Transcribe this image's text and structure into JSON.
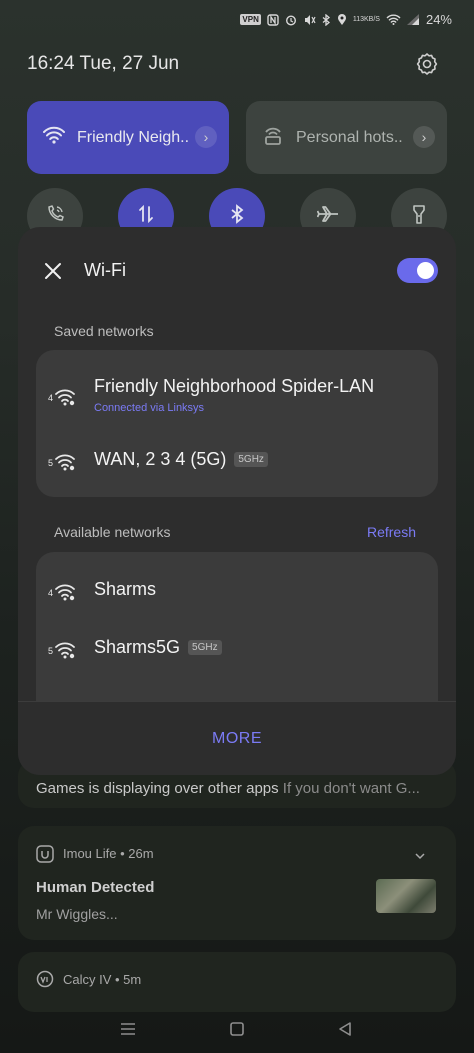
{
  "status_bar": {
    "vpn": "VPN",
    "net_speed_value": "113",
    "net_speed_unit": "KB/S",
    "battery": "24%",
    "icons": [
      "vpn-icon",
      "nfc-icon",
      "alarm-icon",
      "mute-icon",
      "bluetooth-icon",
      "location-icon",
      "wifi-icon",
      "signal-icon"
    ]
  },
  "header": {
    "datetime": "16:24  Tue, 27 Jun"
  },
  "quick_tiles": [
    {
      "label": "Friendly Neigh..",
      "icon": "wifi-icon",
      "active": true
    },
    {
      "label": "Personal hots..",
      "icon": "hotspot-icon",
      "active": false
    }
  ],
  "quick_toggles": [
    {
      "icon": "wifi-calling-icon",
      "active": false
    },
    {
      "icon": "mobile-data-icon",
      "active": true
    },
    {
      "icon": "bluetooth-icon",
      "active": true
    },
    {
      "icon": "airplane-icon",
      "active": false
    },
    {
      "icon": "flashlight-icon",
      "active": false
    }
  ],
  "wifi_dialog": {
    "title": "Wi-Fi",
    "enabled": true,
    "saved_label": "Saved networks",
    "saved": [
      {
        "name": "Friendly Neighborhood Spider-LAN",
        "sub": "Connected via Linksys",
        "generation": "4",
        "band": ""
      },
      {
        "name": "WAN, 2 3 4 (5G)",
        "sub": "",
        "generation": "5",
        "band": "5GHz"
      }
    ],
    "available_label": "Available networks",
    "refresh_label": "Refresh",
    "available": [
      {
        "name": "Sharms",
        "generation": "4",
        "band": ""
      },
      {
        "name": "Sharms5G",
        "generation": "5",
        "band": "5GHz"
      }
    ],
    "more_label": "MORE"
  },
  "notifications": {
    "overlay_title": "Games is displaying over other apps",
    "overlay_body": "If you don't want G...",
    "imou": {
      "app": "Imou Life • 26m",
      "title": "Human Detected",
      "body": "Mr Wiggles..."
    },
    "calcy": {
      "app": "Calcy IV • 5m"
    }
  },
  "colors": {
    "accent": "#7b7bf5",
    "active_tile": "#4a4ab8",
    "dialog_bg": "#2d2d2d",
    "card_bg": "#3b3b3b"
  }
}
